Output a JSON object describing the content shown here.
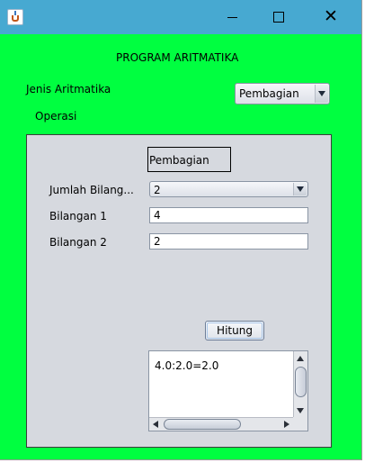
{
  "window": {
    "title": ""
  },
  "main": {
    "title": "PROGRAM ARITMATIKA",
    "jenis_label": "Jenis Aritmatika",
    "jenis_selected": "Pembagian",
    "operasi_label": "Operasi"
  },
  "panel": {
    "operation_name": "Pembagian",
    "jumlah_label": "Jumlah Bilang...",
    "jumlah_selected": "2",
    "bilangan1_label": "Bilangan 1",
    "bilangan1_value": "4",
    "bilangan2_label": "Bilangan 2",
    "bilangan2_value": "2",
    "hitung_label": "Hitung",
    "result_text": "4.0:2.0=2.0"
  },
  "colors": {
    "titlebar": "#47a9d1",
    "content_background": "#00ff40",
    "panel_background": "#d6d9df"
  },
  "icons": [
    "java-app-icon",
    "minimize-icon",
    "maximize-icon",
    "close-icon"
  ]
}
